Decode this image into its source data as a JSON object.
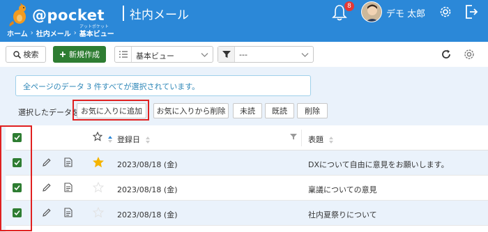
{
  "header": {
    "logo_text": "@pocket",
    "logo_sub": "アットポケット",
    "app_title": "社内メール",
    "breadcrumb": [
      "ホーム",
      "社内メール",
      "基本ビュー"
    ],
    "breadcrumb_sep": "›",
    "notification_count": "8",
    "user_name": "デモ 太郎",
    "colors": {
      "bar": "#2b88d8",
      "badge": "#e53935"
    }
  },
  "toolbar": {
    "search_label": "検索",
    "new_label": "新規作成",
    "view_value": "基本ビュー",
    "filter_value": "---",
    "colors": {
      "new_button": "#2e7d32"
    }
  },
  "notice": {
    "text": "全ページのデータ 3 件すべてが選択されています。"
  },
  "bulk_actions": {
    "label": "選択したデータを",
    "buttons": [
      "お気に入りに追加",
      "お気に入りから削除",
      "未読",
      "既読",
      "削除"
    ]
  },
  "table": {
    "headers": {
      "date": "登録日",
      "subject": "表題"
    },
    "rows": [
      {
        "checked": true,
        "favorite": true,
        "date": "2023/08/18 (金)",
        "subject": "DXについて自由に意見をお願いします。"
      },
      {
        "checked": true,
        "favorite": false,
        "date": "2023/08/18 (金)",
        "subject": "稟議についての意見"
      },
      {
        "checked": true,
        "favorite": false,
        "date": "2023/08/18 (金)",
        "subject": "社内夏祭りについて"
      }
    ]
  },
  "icons": {
    "logo": "kangaroo-logo-icon",
    "bell": "bell-icon",
    "settings": "gear-icon",
    "logout": "logout-icon",
    "search": "search-icon",
    "add": "plus-icon",
    "list": "list-icon",
    "filter": "filter-icon",
    "refresh": "refresh-icon",
    "edit": "pencil-icon",
    "detail": "document-icon",
    "favorite": "star-icon"
  }
}
